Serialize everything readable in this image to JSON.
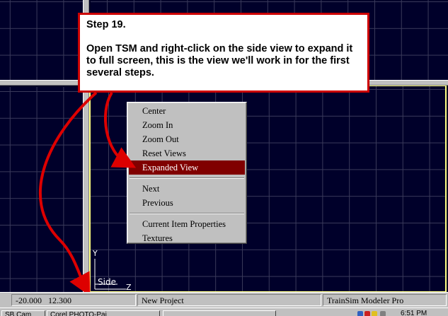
{
  "callout": {
    "title": "Step 19.",
    "body": "Open TSM and right-click on the side view to expand it to full screen, this is the view we'll work in for the first several steps."
  },
  "views": {
    "side": {
      "name": "Side",
      "axis_y": "Y",
      "axis_z": "Z"
    }
  },
  "context_menu": {
    "items": [
      {
        "label": "Center"
      },
      {
        "label": "Zoom In"
      },
      {
        "label": "Zoom Out"
      },
      {
        "label": "Reset Views"
      },
      {
        "label": "Expanded View",
        "selected": true
      }
    ],
    "group2": [
      {
        "label": "Next"
      },
      {
        "label": "Previous"
      }
    ],
    "group3": [
      {
        "label": "Current Item Properties"
      },
      {
        "label": "Textures"
      }
    ]
  },
  "statusbar": {
    "coords": "-20.000   12.300",
    "project": "New Project",
    "app": "TrainSim Modeler Pro"
  },
  "taskbar": {
    "btn1": "SB Cam",
    "btn2": "Corel PHOTO-Pai",
    "clock": "6:51 PM"
  },
  "colors": {
    "callout_border": "#cc0000",
    "arrow": "#dd0000",
    "menu_highlight": "#800000",
    "active_view_border": "#ffff80"
  }
}
